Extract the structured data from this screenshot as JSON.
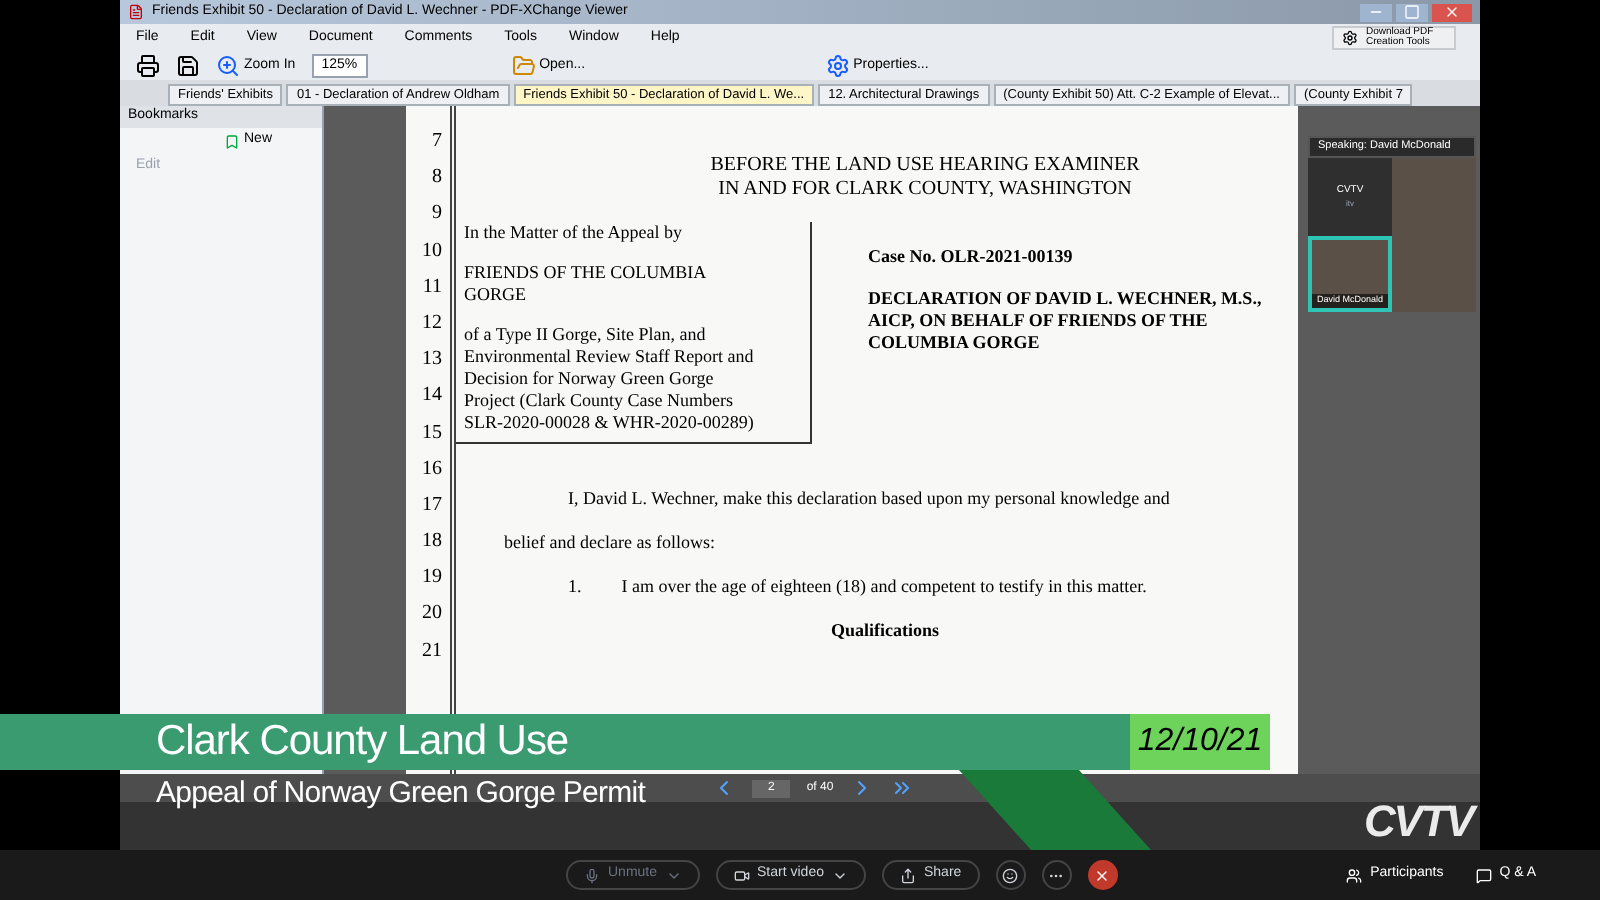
{
  "window": {
    "title": "Friends Exhibit 50 - Declaration of David L. Wechner - PDF-XChange Viewer"
  },
  "menu": [
    "File",
    "Edit",
    "View",
    "Document",
    "Comments",
    "Tools",
    "Window",
    "Help"
  ],
  "toolbar": {
    "zoom_in": "Zoom In",
    "zoom": "125%",
    "open": "Open...",
    "properties": "Properties...",
    "promo": "Download PDF Creation Tools"
  },
  "tabs": [
    {
      "label": "Friends' Exhibits",
      "selected": false
    },
    {
      "label": "01 - Declaration of Andrew Oldham",
      "selected": false
    },
    {
      "label": "Friends Exhibit 50 - Declaration of David L. We...",
      "selected": true
    },
    {
      "label": "12. Architectural Drawings",
      "selected": false
    },
    {
      "label": "(County Exhibit 50) Att. C-2 Example of Elevat...",
      "selected": false
    },
    {
      "label": "(County Exhibit 7",
      "selected": false
    }
  ],
  "bookmarks": {
    "title": "Bookmarks",
    "new": "New",
    "edit": "Edit"
  },
  "document": {
    "line_numbers": [
      "7",
      "8",
      "9",
      "10",
      "11",
      "12",
      "13",
      "14",
      "15",
      "16",
      "17",
      "18",
      "19",
      "20",
      "21"
    ],
    "heading": [
      "BEFORE THE LAND USE HEARING EXAMINER",
      "IN AND FOR CLARK COUNTY, WASHINGTON"
    ],
    "caption": [
      "In the Matter of the Appeal by",
      "FRIENDS OF THE COLUMBIA GORGE",
      "of a Type II Gorge, Site Plan, and Environmental Review Staff Report and Decision for Norway Green Gorge Project (Clark County Case  Numbers SLR-2020-00028 & WHR-2020-00289)"
    ],
    "case_no": "Case No. OLR-2021-00139",
    "title": "DECLARATION OF DAVID L. WECHNER, M.S., AICP, ON BEHALF OF FRIENDS OF THE COLUMBIA GORGE",
    "body": [
      "I, David L. Wechner, make this declaration based upon my personal knowledge and",
      "belief and declare as follows:"
    ],
    "item_number": "1.",
    "item": "I am over the age of eighteen (18) and competent to testify in this matter.",
    "section": "Qualifications"
  },
  "status": {
    "page": "2",
    "of": "of 40"
  },
  "meeting": {
    "speaking": "Speaking: David McDonald",
    "tiles": [
      {
        "kind": "text",
        "label": "CVTV",
        "sub": "itv",
        "selected": false
      },
      {
        "kind": "video",
        "selected": false
      },
      {
        "kind": "video",
        "label": "David McDonald",
        "selected": true
      },
      {
        "kind": "video",
        "selected": false
      }
    ]
  },
  "banner": {
    "title": "Clark County Land Use",
    "subtitle": "Appeal of Norway Green Gorge Permit",
    "date": "12/10/21",
    "logo": "CVTV"
  },
  "controls": {
    "unmute": "Unmute",
    "video": "Start video",
    "share": "Share",
    "participants": "Participants",
    "qa": "Q & A"
  }
}
